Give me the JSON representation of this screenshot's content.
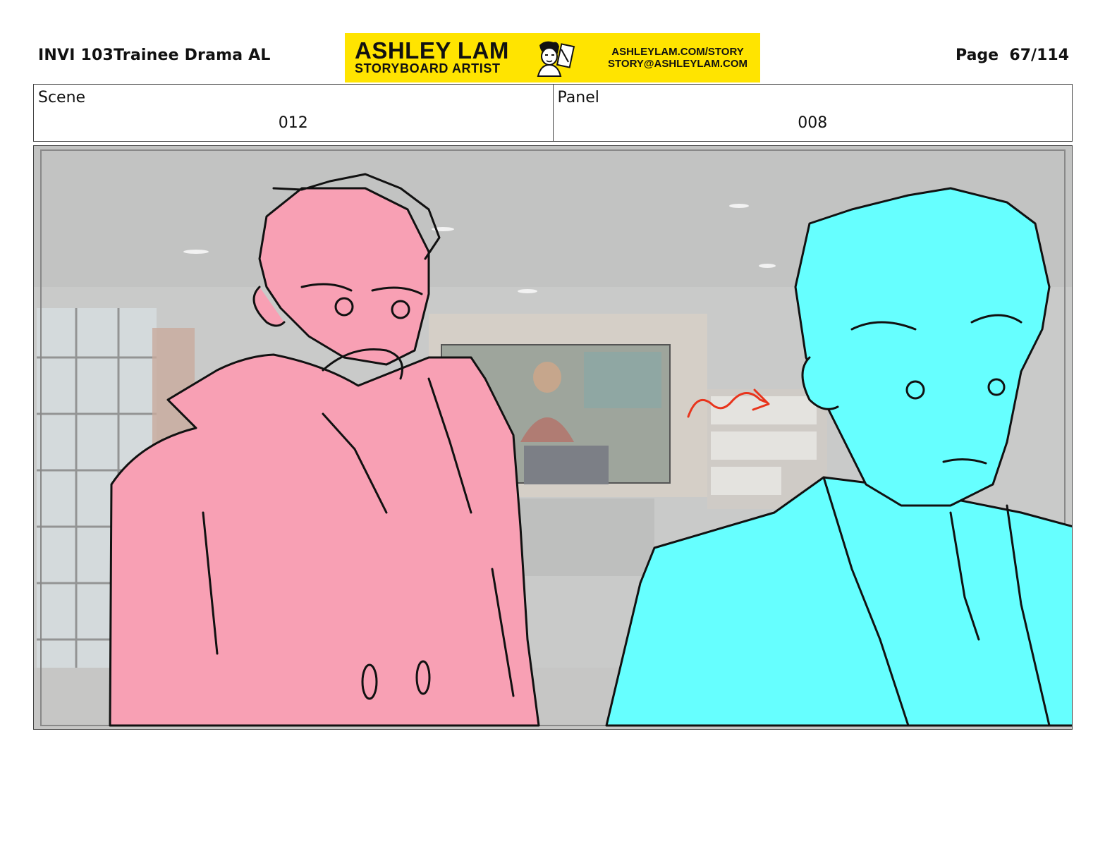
{
  "header": {
    "doc_title": "INVI 103Trainee Drama AL",
    "page_label": "Page",
    "page_number": "67/114"
  },
  "banner": {
    "name": "ASHLEY LAM",
    "role": "STORYBOARD ARTIST",
    "website": "ASHLEYLAM.COM/STORY",
    "email": "STORY@ASHLEYLAM.COM",
    "background": "#ffe400",
    "avatar_icon": "artist-caricature-icon"
  },
  "info": {
    "scene_label": "Scene",
    "scene_value": "012",
    "panel_label": "Panel",
    "panel_value": "008"
  },
  "panel": {
    "left_figure_color": "#f8a0b4",
    "right_figure_color": "#66ffff",
    "motion_arrow_color": "#e8341c"
  }
}
